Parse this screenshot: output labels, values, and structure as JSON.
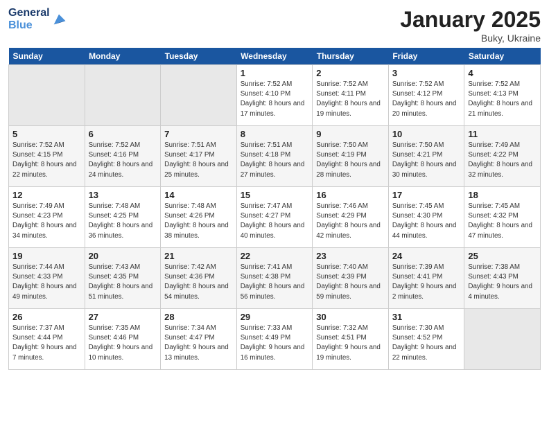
{
  "header": {
    "logo_line1": "General",
    "logo_line2": "Blue",
    "month_title": "January 2025",
    "location": "Buky, Ukraine"
  },
  "weekdays": [
    "Sunday",
    "Monday",
    "Tuesday",
    "Wednesday",
    "Thursday",
    "Friday",
    "Saturday"
  ],
  "weeks": [
    [
      {
        "day": "",
        "sunrise": "",
        "sunset": "",
        "daylight": ""
      },
      {
        "day": "",
        "sunrise": "",
        "sunset": "",
        "daylight": ""
      },
      {
        "day": "",
        "sunrise": "",
        "sunset": "",
        "daylight": ""
      },
      {
        "day": "1",
        "sunrise": "Sunrise: 7:52 AM",
        "sunset": "Sunset: 4:10 PM",
        "daylight": "Daylight: 8 hours and 17 minutes."
      },
      {
        "day": "2",
        "sunrise": "Sunrise: 7:52 AM",
        "sunset": "Sunset: 4:11 PM",
        "daylight": "Daylight: 8 hours and 19 minutes."
      },
      {
        "day": "3",
        "sunrise": "Sunrise: 7:52 AM",
        "sunset": "Sunset: 4:12 PM",
        "daylight": "Daylight: 8 hours and 20 minutes."
      },
      {
        "day": "4",
        "sunrise": "Sunrise: 7:52 AM",
        "sunset": "Sunset: 4:13 PM",
        "daylight": "Daylight: 8 hours and 21 minutes."
      }
    ],
    [
      {
        "day": "5",
        "sunrise": "Sunrise: 7:52 AM",
        "sunset": "Sunset: 4:15 PM",
        "daylight": "Daylight: 8 hours and 22 minutes."
      },
      {
        "day": "6",
        "sunrise": "Sunrise: 7:52 AM",
        "sunset": "Sunset: 4:16 PM",
        "daylight": "Daylight: 8 hours and 24 minutes."
      },
      {
        "day": "7",
        "sunrise": "Sunrise: 7:51 AM",
        "sunset": "Sunset: 4:17 PM",
        "daylight": "Daylight: 8 hours and 25 minutes."
      },
      {
        "day": "8",
        "sunrise": "Sunrise: 7:51 AM",
        "sunset": "Sunset: 4:18 PM",
        "daylight": "Daylight: 8 hours and 27 minutes."
      },
      {
        "day": "9",
        "sunrise": "Sunrise: 7:50 AM",
        "sunset": "Sunset: 4:19 PM",
        "daylight": "Daylight: 8 hours and 28 minutes."
      },
      {
        "day": "10",
        "sunrise": "Sunrise: 7:50 AM",
        "sunset": "Sunset: 4:21 PM",
        "daylight": "Daylight: 8 hours and 30 minutes."
      },
      {
        "day": "11",
        "sunrise": "Sunrise: 7:49 AM",
        "sunset": "Sunset: 4:22 PM",
        "daylight": "Daylight: 8 hours and 32 minutes."
      }
    ],
    [
      {
        "day": "12",
        "sunrise": "Sunrise: 7:49 AM",
        "sunset": "Sunset: 4:23 PM",
        "daylight": "Daylight: 8 hours and 34 minutes."
      },
      {
        "day": "13",
        "sunrise": "Sunrise: 7:48 AM",
        "sunset": "Sunset: 4:25 PM",
        "daylight": "Daylight: 8 hours and 36 minutes."
      },
      {
        "day": "14",
        "sunrise": "Sunrise: 7:48 AM",
        "sunset": "Sunset: 4:26 PM",
        "daylight": "Daylight: 8 hours and 38 minutes."
      },
      {
        "day": "15",
        "sunrise": "Sunrise: 7:47 AM",
        "sunset": "Sunset: 4:27 PM",
        "daylight": "Daylight: 8 hours and 40 minutes."
      },
      {
        "day": "16",
        "sunrise": "Sunrise: 7:46 AM",
        "sunset": "Sunset: 4:29 PM",
        "daylight": "Daylight: 8 hours and 42 minutes."
      },
      {
        "day": "17",
        "sunrise": "Sunrise: 7:45 AM",
        "sunset": "Sunset: 4:30 PM",
        "daylight": "Daylight: 8 hours and 44 minutes."
      },
      {
        "day": "18",
        "sunrise": "Sunrise: 7:45 AM",
        "sunset": "Sunset: 4:32 PM",
        "daylight": "Daylight: 8 hours and 47 minutes."
      }
    ],
    [
      {
        "day": "19",
        "sunrise": "Sunrise: 7:44 AM",
        "sunset": "Sunset: 4:33 PM",
        "daylight": "Daylight: 8 hours and 49 minutes."
      },
      {
        "day": "20",
        "sunrise": "Sunrise: 7:43 AM",
        "sunset": "Sunset: 4:35 PM",
        "daylight": "Daylight: 8 hours and 51 minutes."
      },
      {
        "day": "21",
        "sunrise": "Sunrise: 7:42 AM",
        "sunset": "Sunset: 4:36 PM",
        "daylight": "Daylight: 8 hours and 54 minutes."
      },
      {
        "day": "22",
        "sunrise": "Sunrise: 7:41 AM",
        "sunset": "Sunset: 4:38 PM",
        "daylight": "Daylight: 8 hours and 56 minutes."
      },
      {
        "day": "23",
        "sunrise": "Sunrise: 7:40 AM",
        "sunset": "Sunset: 4:39 PM",
        "daylight": "Daylight: 8 hours and 59 minutes."
      },
      {
        "day": "24",
        "sunrise": "Sunrise: 7:39 AM",
        "sunset": "Sunset: 4:41 PM",
        "daylight": "Daylight: 9 hours and 2 minutes."
      },
      {
        "day": "25",
        "sunrise": "Sunrise: 7:38 AM",
        "sunset": "Sunset: 4:43 PM",
        "daylight": "Daylight: 9 hours and 4 minutes."
      }
    ],
    [
      {
        "day": "26",
        "sunrise": "Sunrise: 7:37 AM",
        "sunset": "Sunset: 4:44 PM",
        "daylight": "Daylight: 9 hours and 7 minutes."
      },
      {
        "day": "27",
        "sunrise": "Sunrise: 7:35 AM",
        "sunset": "Sunset: 4:46 PM",
        "daylight": "Daylight: 9 hours and 10 minutes."
      },
      {
        "day": "28",
        "sunrise": "Sunrise: 7:34 AM",
        "sunset": "Sunset: 4:47 PM",
        "daylight": "Daylight: 9 hours and 13 minutes."
      },
      {
        "day": "29",
        "sunrise": "Sunrise: 7:33 AM",
        "sunset": "Sunset: 4:49 PM",
        "daylight": "Daylight: 9 hours and 16 minutes."
      },
      {
        "day": "30",
        "sunrise": "Sunrise: 7:32 AM",
        "sunset": "Sunset: 4:51 PM",
        "daylight": "Daylight: 9 hours and 19 minutes."
      },
      {
        "day": "31",
        "sunrise": "Sunrise: 7:30 AM",
        "sunset": "Sunset: 4:52 PM",
        "daylight": "Daylight: 9 hours and 22 minutes."
      },
      {
        "day": "",
        "sunrise": "",
        "sunset": "",
        "daylight": ""
      }
    ]
  ]
}
